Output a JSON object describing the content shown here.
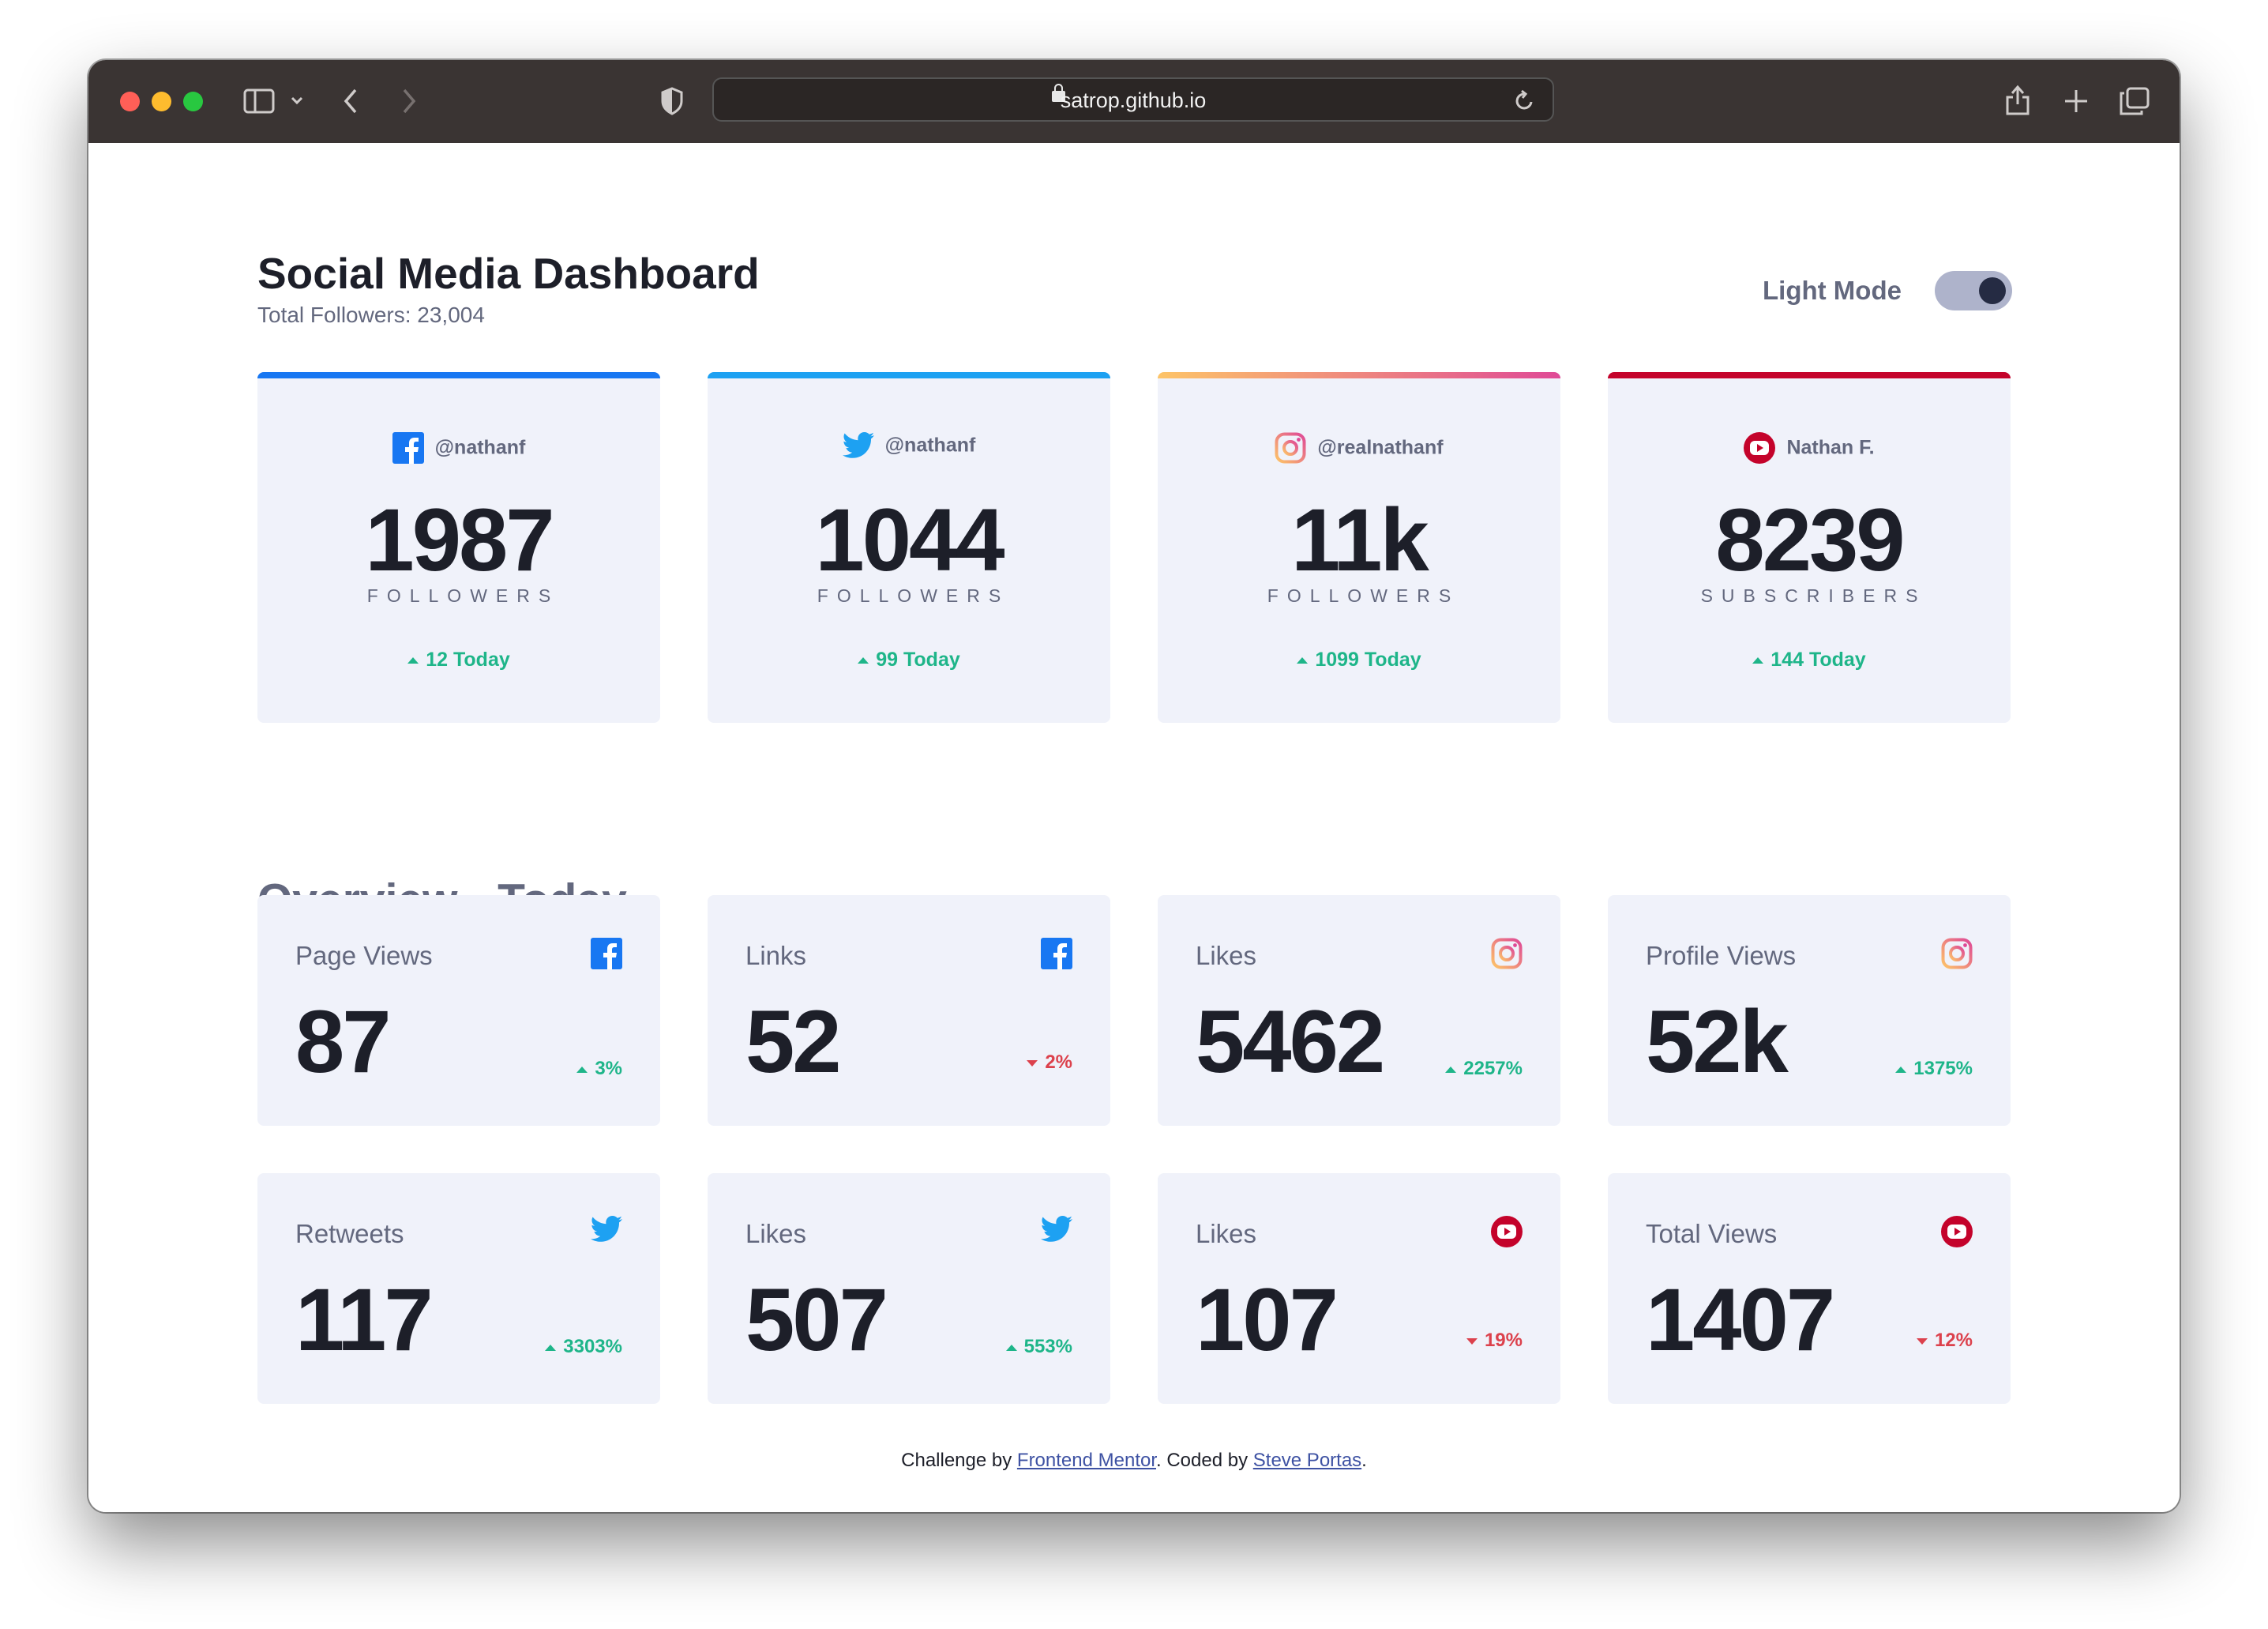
{
  "browser": {
    "url": "satrop.github.io"
  },
  "header": {
    "title": "Social Media Dashboard",
    "total_followers": "Total Followers: 23,004",
    "mode_label": "Light Mode"
  },
  "colors": {
    "facebook": "#1877f2",
    "twitter": "#1da1f2",
    "instagram_start": "#fdc468",
    "instagram_end": "#df4996",
    "youtube": "#c4032b",
    "up": "#1eb589",
    "down": "#dc414c"
  },
  "followers": [
    {
      "icon": "facebook-icon",
      "handle": "@nathanf",
      "count": "1987",
      "unit": "FOLLOWERS",
      "today": "12 Today"
    },
    {
      "icon": "twitter-icon",
      "handle": "@nathanf",
      "count": "1044",
      "unit": "FOLLOWERS",
      "today": "99 Today"
    },
    {
      "icon": "instagram-icon",
      "handle": "@realnathanf",
      "count": "11k",
      "unit": "FOLLOWERS",
      "today": "1099 Today"
    },
    {
      "icon": "youtube-icon",
      "handle": "Nathan F.",
      "count": "8239",
      "unit": "SUBSCRIBERS",
      "today": "144 Today"
    }
  ],
  "overview": {
    "title": "Overview - Today",
    "items": [
      {
        "label": "Page Views",
        "icon": "facebook-icon",
        "value": "87",
        "change": "3%",
        "direction": "up"
      },
      {
        "label": "Links",
        "icon": "facebook-icon",
        "value": "52",
        "change": "2%",
        "direction": "down"
      },
      {
        "label": "Likes",
        "icon": "instagram-icon",
        "value": "5462",
        "change": "2257%",
        "direction": "up"
      },
      {
        "label": "Profile Views",
        "icon": "instagram-icon",
        "value": "52k",
        "change": "1375%",
        "direction": "up"
      },
      {
        "label": "Retweets",
        "icon": "twitter-icon",
        "value": "117",
        "change": "3303%",
        "direction": "up"
      },
      {
        "label": "Likes",
        "icon": "twitter-icon",
        "value": "507",
        "change": "553%",
        "direction": "up"
      },
      {
        "label": "Likes",
        "icon": "youtube-icon",
        "value": "107",
        "change": "19%",
        "direction": "down"
      },
      {
        "label": "Total Views",
        "icon": "youtube-icon",
        "value": "1407",
        "change": "12%",
        "direction": "down"
      }
    ]
  },
  "footer": {
    "prefix": "Challenge by ",
    "link1": "Frontend Mentor",
    "middle": ". Coded by ",
    "link2": "Steve Portas",
    "suffix": "."
  }
}
